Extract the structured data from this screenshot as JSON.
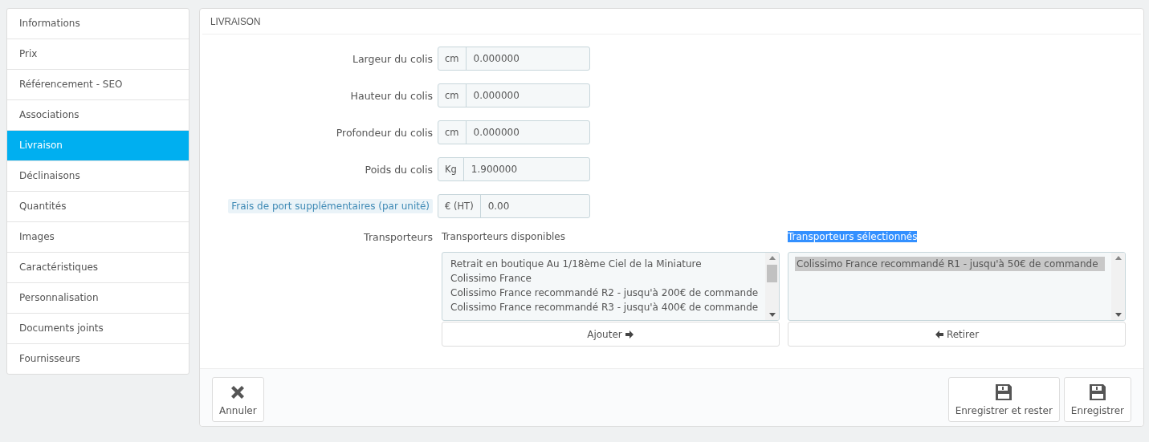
{
  "sidebar": {
    "items": [
      {
        "label": "Informations",
        "selected": false
      },
      {
        "label": "Prix",
        "selected": false
      },
      {
        "label": "Référencement - SEO",
        "selected": false
      },
      {
        "label": "Associations",
        "selected": false
      },
      {
        "label": "Livraison",
        "selected": true
      },
      {
        "label": "Déclinaisons",
        "selected": false
      },
      {
        "label": "Quantités",
        "selected": false
      },
      {
        "label": "Images",
        "selected": false
      },
      {
        "label": "Caractéristiques",
        "selected": false
      },
      {
        "label": "Personnalisation",
        "selected": false
      },
      {
        "label": "Documents joints",
        "selected": false
      },
      {
        "label": "Fournisseurs",
        "selected": false
      }
    ]
  },
  "panel": {
    "title": "LIVRAISON",
    "fields": [
      {
        "label": "Largeur du colis",
        "unit": "cm",
        "value": "0.000000",
        "help": false
      },
      {
        "label": "Hauteur du colis",
        "unit": "cm",
        "value": "0.000000",
        "help": false
      },
      {
        "label": "Profondeur du colis",
        "unit": "cm",
        "value": "0.000000",
        "help": false
      },
      {
        "label": "Poids du colis",
        "unit": "Kg",
        "value": "1.900000",
        "help": false
      },
      {
        "label": "Frais de port supplémentaires (par unité)",
        "unit": "€ (HT)",
        "value": "0.00",
        "help": true
      }
    ],
    "carriers": {
      "label": "Transporteurs",
      "available": {
        "title": "Transporteurs disponibles",
        "highlighted": false,
        "items": [
          {
            "label": "Retrait en boutique Au 1/18ème Ciel de la Miniature",
            "selected": false
          },
          {
            "label": "Colissimo France",
            "selected": false
          },
          {
            "label": "Colissimo France recommandé R2 - jusqu'à 200€ de commande",
            "selected": false
          },
          {
            "label": "Colissimo France recommandé R3 - jusqu'à 400€ de commande",
            "selected": false
          }
        ],
        "button": "Ajouter"
      },
      "chosen": {
        "title": "Transporteurs sélectionnés",
        "highlighted": true,
        "items": [
          {
            "label": "Colissimo France recommandé R1 - jusqu'à 50€ de commande",
            "selected": true
          }
        ],
        "button": "Retirer"
      }
    },
    "footer": {
      "cancel": "Annuler",
      "save_stay": "Enregistrer et rester",
      "save": "Enregistrer"
    }
  }
}
